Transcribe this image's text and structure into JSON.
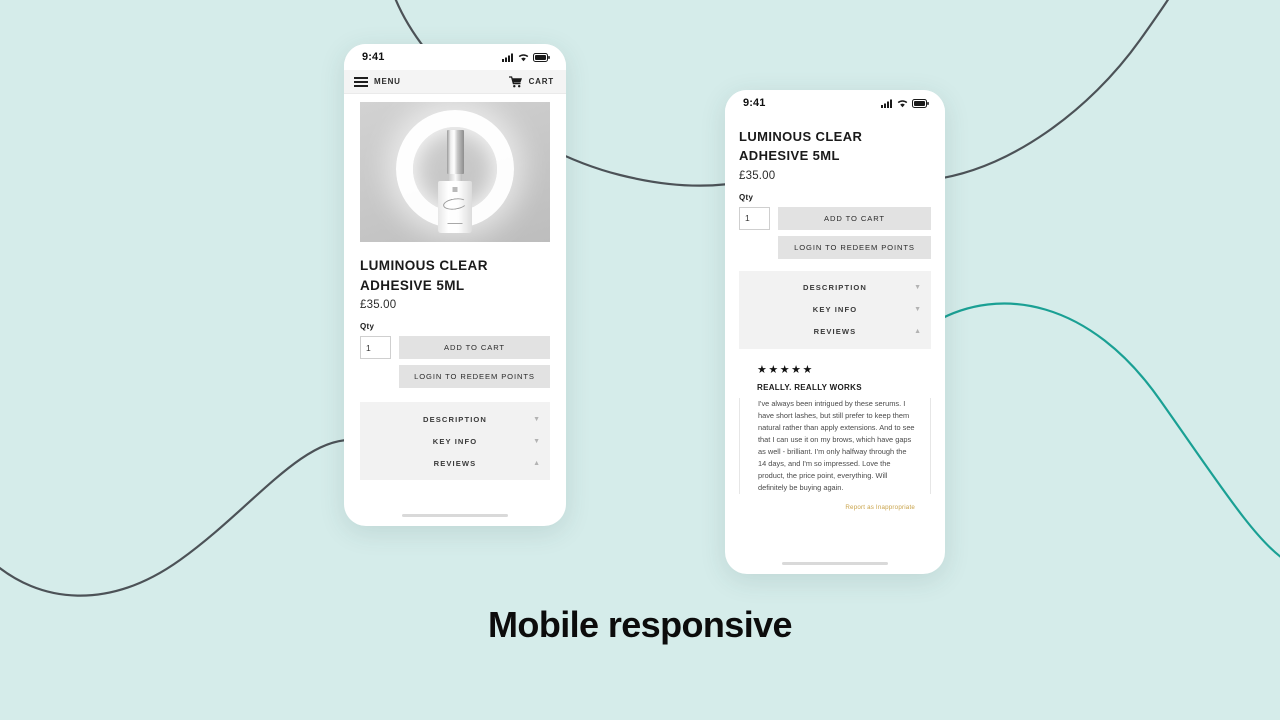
{
  "background": {
    "color": "#d5ecea",
    "curve_color": "#4c5257",
    "accent_color": "#1aa094"
  },
  "caption": "Mobile responsive",
  "phone_one": {
    "status_bar": {
      "time": "9:41",
      "icons": [
        "cellular-signal-icon",
        "wifi-icon",
        "battery-icon"
      ]
    },
    "nav": {
      "menu_label": "MENU",
      "menu_icon": "hamburger-icon",
      "cart_label": "CART",
      "cart_icon": "shopping-cart-icon"
    },
    "product": {
      "image_alt": "luminous clear adhesive bottle on grey backdrop with glowing ring",
      "title": "LUMINOUS CLEAR ADHESIVE 5ML",
      "price": "£35.00",
      "qty_label": "Qty",
      "qty_value": "1",
      "add_to_cart_label": "ADD TO CART",
      "redeem_label": "LOGIN TO REDEEM POINTS"
    },
    "accordion": [
      {
        "label": "DESCRIPTION",
        "caret": "▼",
        "expanded": false
      },
      {
        "label": "KEY INFO",
        "caret": "▼",
        "expanded": false
      },
      {
        "label": "REVIEWS",
        "caret": "▲",
        "expanded": true
      }
    ]
  },
  "phone_two": {
    "status_bar": {
      "time": "9:41",
      "icons": [
        "cellular-signal-icon",
        "wifi-icon",
        "battery-icon"
      ]
    },
    "product": {
      "title": "LUMINOUS CLEAR ADHESIVE 5ML",
      "price": "£35.00",
      "qty_label": "Qty",
      "qty_value": "1",
      "add_to_cart_label": "ADD TO CART",
      "redeem_label": "LOGIN TO REDEEM POINTS"
    },
    "accordion": [
      {
        "label": "DESCRIPTION",
        "caret": "▼",
        "expanded": false
      },
      {
        "label": "KEY INFO",
        "caret": "▼",
        "expanded": false
      },
      {
        "label": "REVIEWS",
        "caret": "▲",
        "expanded": true
      }
    ],
    "review": {
      "stars": "★★★★★",
      "rating": 5,
      "title": "REALLY. REALLY WORKS",
      "body": "I've always been intrigued by these serums. I have short lashes, but still prefer to keep them natural rather than apply extensions. And to see that I can use it on my brows, which have gaps as well - brilliant. I'm only halfway through the 14 days, and I'm so impressed. Love the product, the price point, everything. Will definitely be buying again.",
      "report_label": "Report as Inappropriate"
    }
  }
}
